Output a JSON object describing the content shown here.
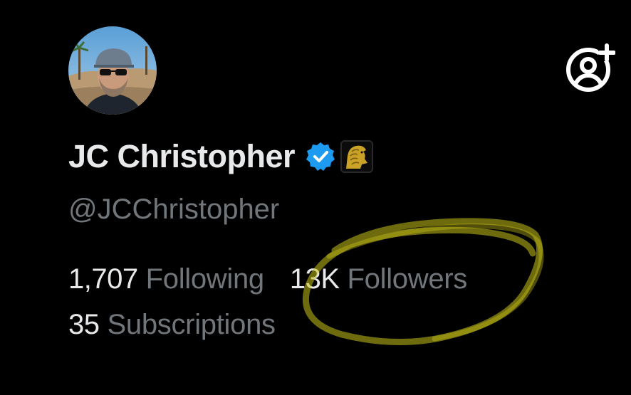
{
  "profile": {
    "display_name": "JC Christopher",
    "handle": "@JCChristopher",
    "verified": true,
    "affiliate_badge": "gold-lion-badge"
  },
  "stats": {
    "following_count": "1,707",
    "following_label": "Following",
    "followers_count": "13K",
    "followers_label": "Followers",
    "subscriptions_count": "35",
    "subscriptions_label": "Subscriptions"
  },
  "actions": {
    "follow_icon": "person-add-icon"
  },
  "annotation": {
    "type": "hand-drawn-circle",
    "color": "#c9c21a",
    "target": "followers"
  },
  "colors": {
    "background": "#000000",
    "primary_text": "#e7e9ea",
    "secondary_text": "#71767b",
    "verified_blue": "#1d9bf0",
    "badge_gold": "#c9a227"
  }
}
